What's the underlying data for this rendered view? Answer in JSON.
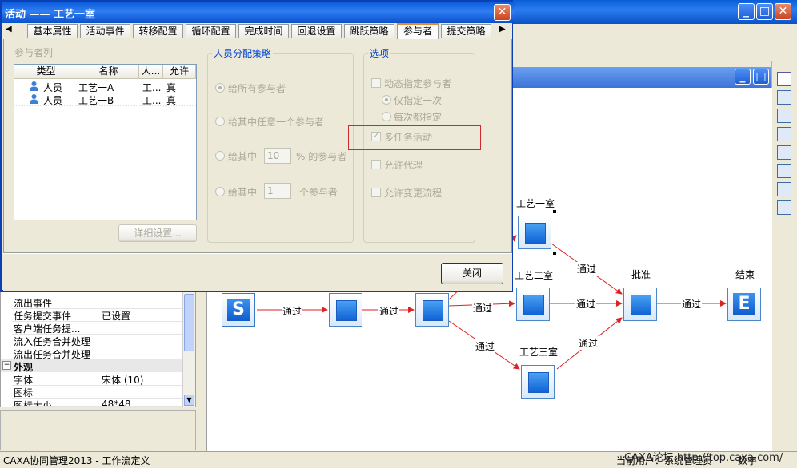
{
  "window": {
    "status_left": "CAXA协同管理2013 - 工作流定义",
    "status_right_user": "当前用户：系统管理员",
    "status_right_num": "数字",
    "watermark": "CAXA论坛 http://top.caxa.com/"
  },
  "dialog": {
    "title": "活动 —— 工艺一室",
    "tabs": [
      "基本属性",
      "活动事件",
      "转移配置",
      "循环配置",
      "完成时间",
      "回退设置",
      "跳跃策略",
      "参与者",
      "提交策略"
    ],
    "active_tab": "参与者",
    "participants": {
      "group_title": "参与者列",
      "columns": [
        "类型",
        "名称",
        "人...",
        "允许"
      ],
      "rows": [
        {
          "type": "人员",
          "name": "工艺一A",
          "person": "工...",
          "allow": "真"
        },
        {
          "type": "人员",
          "name": "工艺一B",
          "person": "工...",
          "allow": "真"
        }
      ],
      "detail_button": "详细设置..."
    },
    "strategy": {
      "group_title": "人员分配策略",
      "opt_all": "给所有参与者",
      "opt_any": "给其中任意一个参与者",
      "opt_percent_prefix": "给其中",
      "opt_percent_value": "10",
      "opt_percent_suffix": "% 的参与者",
      "opt_count_prefix": "给其中",
      "opt_count_value": "1",
      "opt_count_suffix": "个参与者"
    },
    "options": {
      "group_title": "选项",
      "dynamic": "动态指定参与者",
      "once": "仅指定一次",
      "every": "每次都指定",
      "multitask": "多任务活动",
      "proxy": "允许代理",
      "change_flow": "允许变更流程"
    },
    "close_button": "关闭"
  },
  "properties": {
    "rows": [
      {
        "key": "流出事件",
        "value": ""
      },
      {
        "key": "任务提交事件",
        "value": "已设置"
      },
      {
        "key": "客户端任务提...",
        "value": ""
      },
      {
        "key": "流入任务合并处理",
        "value": ""
      },
      {
        "key": "流出任务合并处理",
        "value": ""
      }
    ],
    "section": "外观",
    "appearance": [
      {
        "key": "字体",
        "value": "宋体 (10)"
      },
      {
        "key": "图标",
        "value": ""
      },
      {
        "key": "图标大小",
        "value": "48*48"
      }
    ]
  },
  "workflow": {
    "edge_label": "通过",
    "nodes": {
      "craft1": "工艺一室",
      "craft2": "工艺二室",
      "craft3": "工艺三室",
      "approve": "批准",
      "end": "结束"
    }
  }
}
